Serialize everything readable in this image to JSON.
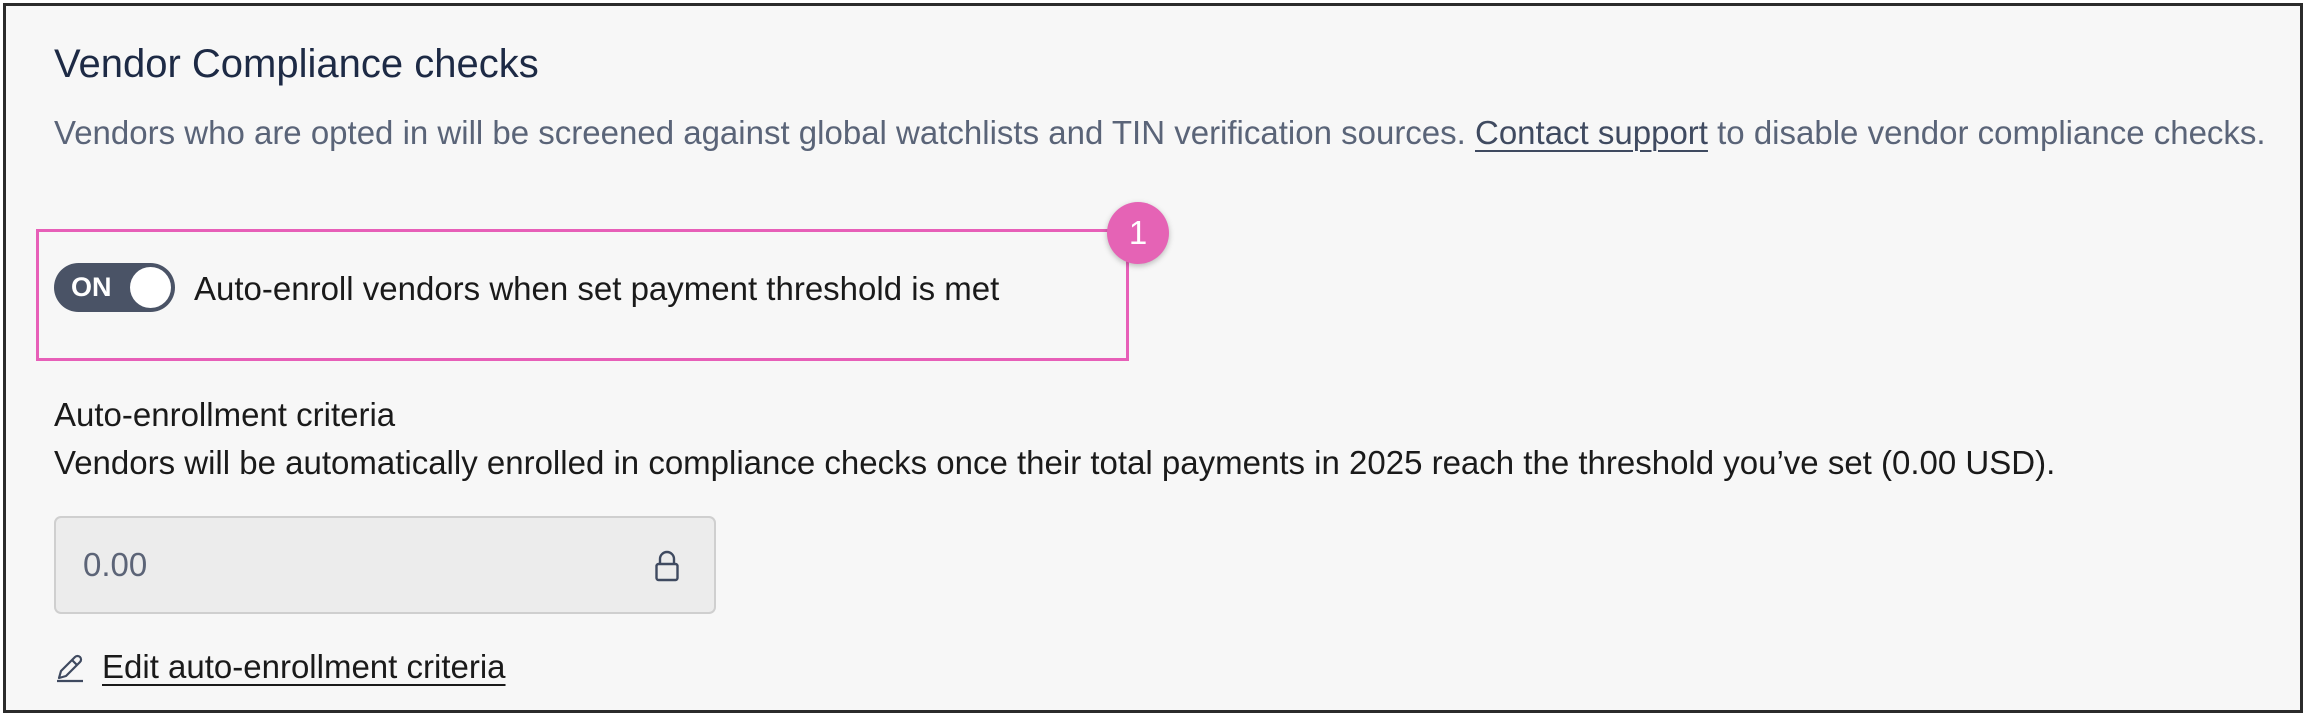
{
  "section": {
    "title": "Vendor Compliance checks",
    "description_before_link": "Vendors who are opted in will be screened against global watchlists and TIN verification sources. ",
    "contact_link": "Contact support",
    "description_after_link": " to disable vendor compliance checks."
  },
  "auto_enroll": {
    "toggle_state": "ON",
    "toggle_label": "Auto-enroll vendors when set payment threshold is met",
    "step_badge": "1",
    "highlight_color": "#e75fb8",
    "badge_color": "#e563b5"
  },
  "criteria": {
    "heading": "Auto-enrollment criteria",
    "description": "Vendors will be automatically enrolled in compliance checks once their total payments in 2025 reach the threshold you’ve set (0.00 USD).",
    "threshold_value": "0.00",
    "lock_icon": "lock-icon",
    "edit_link": "Edit auto-enrollment criteria",
    "edit_icon": "pencil-icon"
  },
  "colors": {
    "toggle_bg": "#4a5366",
    "title": "#1d2a45",
    "muted_text": "#5a6478"
  }
}
